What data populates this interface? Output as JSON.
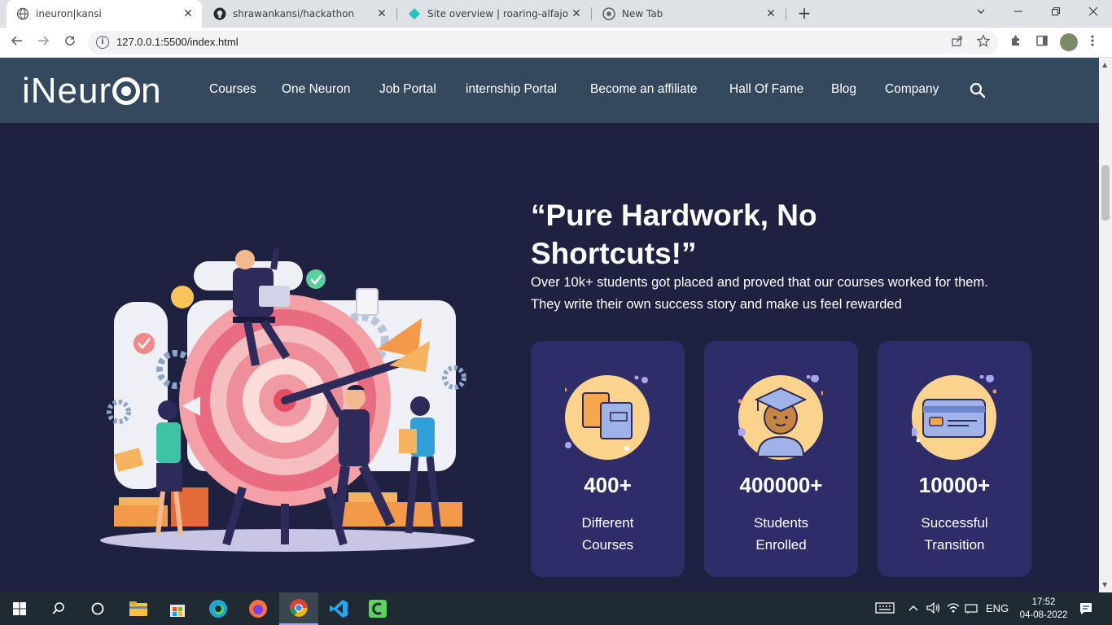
{
  "browser": {
    "tabs": [
      {
        "title": "ineuron|kansi",
        "favicon": "globe-icon",
        "active": true
      },
      {
        "title": "shrawankansi/hackathon",
        "favicon": "github-icon",
        "active": false
      },
      {
        "title": "Site overview | roaring-alfajores-",
        "favicon": "netlify-icon",
        "active": false
      },
      {
        "title": "New Tab",
        "favicon": "chrome-icon",
        "active": false
      }
    ],
    "new_tab": "+",
    "url": "127.0.0.1:5500/index.html"
  },
  "site": {
    "logo_pre": "iNeur",
    "logo_post": "n",
    "nav": [
      "Courses",
      "One Neuron",
      "Job Portal",
      "internship Portal",
      "Become an affiliate",
      "Hall Of Fame",
      "Blog",
      "Company"
    ],
    "headline_line1": "“Pure Hardwork, No",
    "headline_line2": "Shortcuts!”",
    "subtext_line1": "Over 10k+ students got placed and proved that our courses worked for them.",
    "subtext_line2": "They write their own success story and make us feel rewarded",
    "stats": [
      {
        "number": "400+",
        "label1": "Different",
        "label2": "Courses",
        "icon": "books-icon"
      },
      {
        "number": "400000+",
        "label1": "Students",
        "label2": "Enrolled",
        "icon": "graduate-icon"
      },
      {
        "number": "10000+",
        "label1": "Successful",
        "label2": "Transition",
        "icon": "credit-card-icon"
      }
    ],
    "colors": {
      "header": "#34495e",
      "hero": "#1e2140",
      "card": "#2f2c6a",
      "badge": "#fbd38d"
    }
  },
  "taskbar": {
    "language": "ENG",
    "time": "17:52",
    "date": "04-08-2022"
  }
}
